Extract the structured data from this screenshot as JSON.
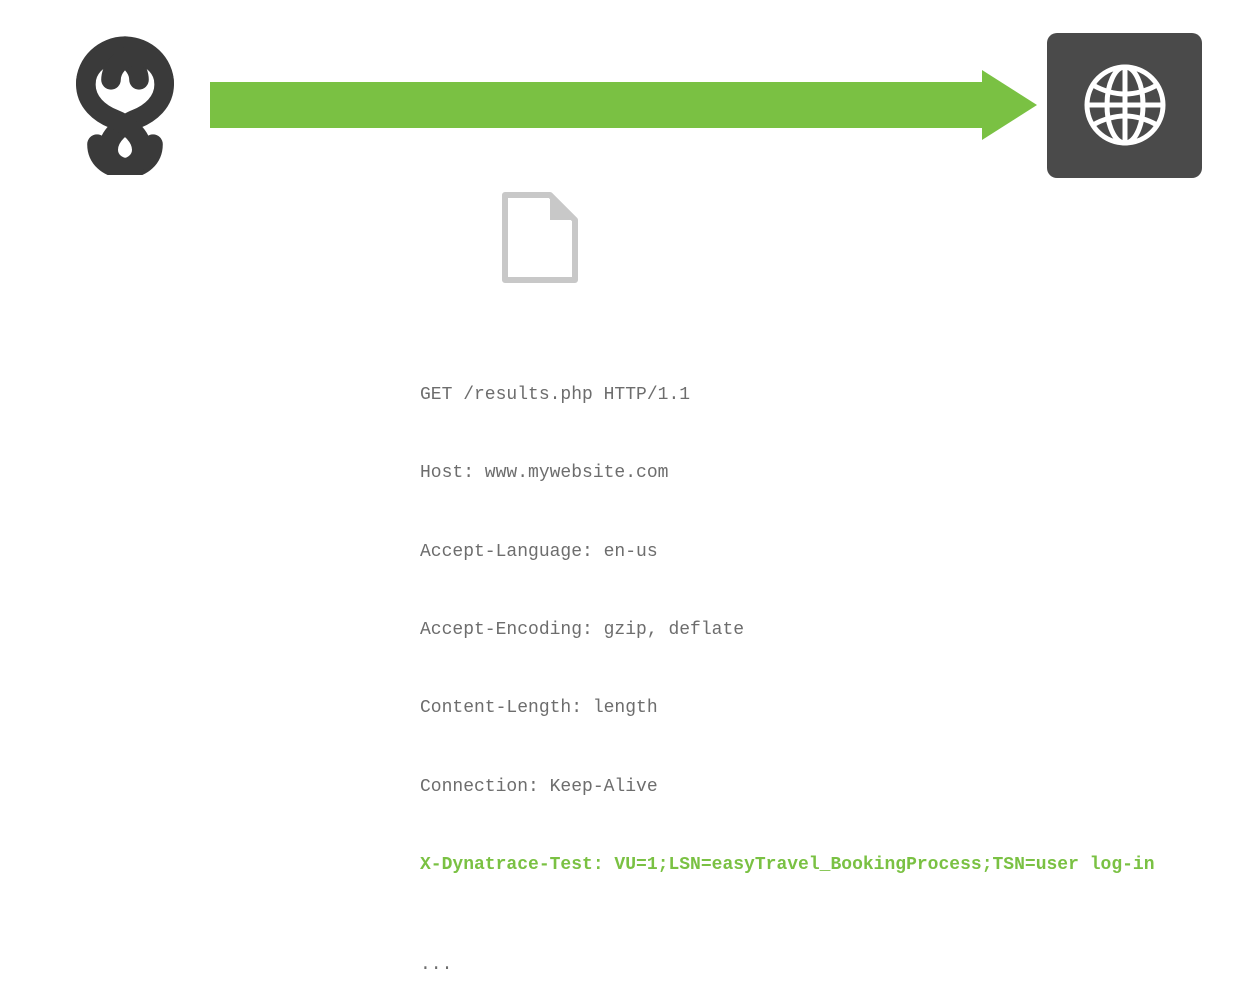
{
  "diagram": {
    "arrow_color": "#7ac143",
    "target_box_color": "#4a4a4a"
  },
  "http_request": {
    "lines": [
      "GET /results.php HTTP/1.1",
      "Host: www.mywebsite.com",
      "Accept-Language: en-us",
      "Accept-Encoding: gzip, deflate",
      "Content-Length: length",
      "Connection: Keep-Alive"
    ],
    "highlight": "X-Dynatrace-Test: VU=1;LSN=easyTravel_BookingProcess;TSN=user log-in",
    "ellipsis": "..."
  }
}
